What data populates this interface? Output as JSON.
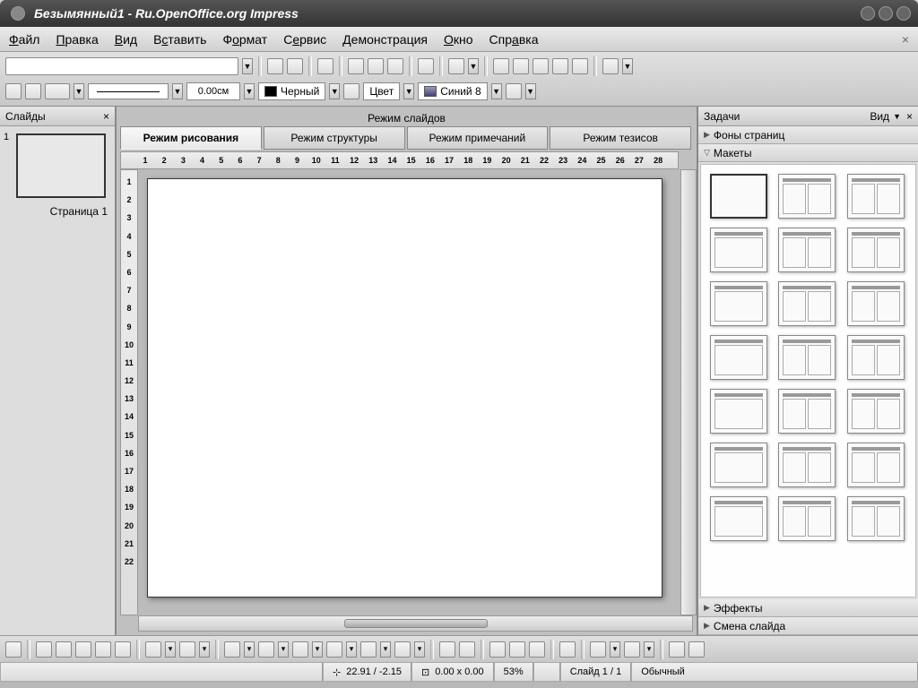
{
  "title": "Безымянный1 - Ru.OpenOffice.org Impress",
  "menu": {
    "file": "Файл",
    "edit": "Правка",
    "view": "Вид",
    "insert": "Вставить",
    "format": "Формат",
    "service": "Сервис",
    "demo": "Демонстрация",
    "window": "Окно",
    "help": "Справка"
  },
  "row2": {
    "width": "0.00см",
    "black": "Черный",
    "color": "Цвет",
    "blue": "Синий 8"
  },
  "panel": {
    "slides": "Слайды",
    "slide1": "Страница 1",
    "slidesMode": "Режим слайдов",
    "tab1": "Режим рисования",
    "tab2": "Режим структуры",
    "tab3": "Режим примечаний",
    "tab4": "Режим тезисов"
  },
  "rulerH": [
    "1",
    "2",
    "3",
    "4",
    "5",
    "6",
    "7",
    "8",
    "9",
    "10",
    "11",
    "12",
    "13",
    "14",
    "15",
    "16",
    "17",
    "18",
    "19",
    "20",
    "21",
    "22",
    "23",
    "24",
    "25",
    "26",
    "27",
    "28"
  ],
  "rulerV": [
    "1",
    "2",
    "3",
    "4",
    "5",
    "6",
    "7",
    "8",
    "9",
    "10",
    "11",
    "12",
    "13",
    "14",
    "15",
    "16",
    "17",
    "18",
    "19",
    "20",
    "21",
    "22"
  ],
  "tasks": {
    "title": "Задачи",
    "view": "Вид",
    "bgs": "Фоны страниц",
    "layouts": "Макеты",
    "effects": "Эффекты",
    "change": "Смена слайда"
  },
  "status": {
    "pos": "22.91 / -2.15",
    "size": "0.00 x 0.00",
    "zoom": "53%",
    "slide": "Слайд 1 / 1",
    "mode": "Обычный"
  }
}
